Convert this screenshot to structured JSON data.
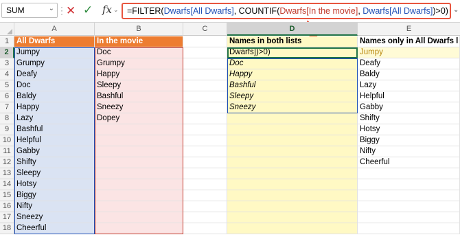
{
  "formula_bar": {
    "name_box": "SUM",
    "formula_parts": [
      {
        "text": "=FILTER(",
        "color": "black"
      },
      {
        "text": "Dwarfs[All Dwarfs]",
        "color": "blue"
      },
      {
        "text": ", COUNTIF(",
        "color": "black"
      },
      {
        "text": "Dwarfs[In the movie]",
        "color": "red"
      },
      {
        "text": ", ",
        "color": "black"
      },
      {
        "text": "Dwarfs[All Dwarfs]",
        "color": "blue"
      },
      {
        "text": ")>0)",
        "color": "black"
      }
    ],
    "icons": [
      "cancel-icon",
      "enter-icon",
      "insert-function-icon"
    ]
  },
  "columns": [
    "A",
    "B",
    "C",
    "D",
    "E"
  ],
  "rows": [
    "1",
    "2",
    "3",
    "4",
    "5",
    "6",
    "7",
    "8",
    "9",
    "10",
    "11",
    "12",
    "13",
    "14",
    "15",
    "16",
    "17",
    "18"
  ],
  "headers": {
    "a1": "All Dwarfs",
    "b1": "In the movie",
    "d1": "Names in both lists",
    "e1": "Names only in All Dwarfs l"
  },
  "all_dwarfs": [
    "Jumpy",
    "Grumpy",
    "Deafy",
    "Doc",
    "Baldy",
    "Happy",
    "Lazy",
    "Bashful",
    "Helpful",
    "Gabby",
    "Shifty",
    "Sleepy",
    "Hotsy",
    "Biggy",
    "Nifty",
    "Sneezy",
    "Cheerful"
  ],
  "in_the_movie": [
    "Doc",
    "Grumpy",
    "Happy",
    "Sleepy",
    "Bashful",
    "Sneezy",
    "Dopey"
  ],
  "editing_cell_text": "Dwarfs])>0)",
  "names_in_both": [
    "Doc",
    "Happy",
    "Bashful",
    "Sleepy",
    "Sneezy"
  ],
  "names_only_in_all": [
    "Jumpy",
    "Deafy",
    "Baldy",
    "Lazy",
    "Helpful",
    "Gabby",
    "Shifty",
    "Hotsy",
    "Biggy",
    "Nifty",
    "Cheerful"
  ],
  "colors": {
    "accent": "#217346",
    "header_orange": "#ed7d31",
    "annotation": "#e8553f"
  }
}
